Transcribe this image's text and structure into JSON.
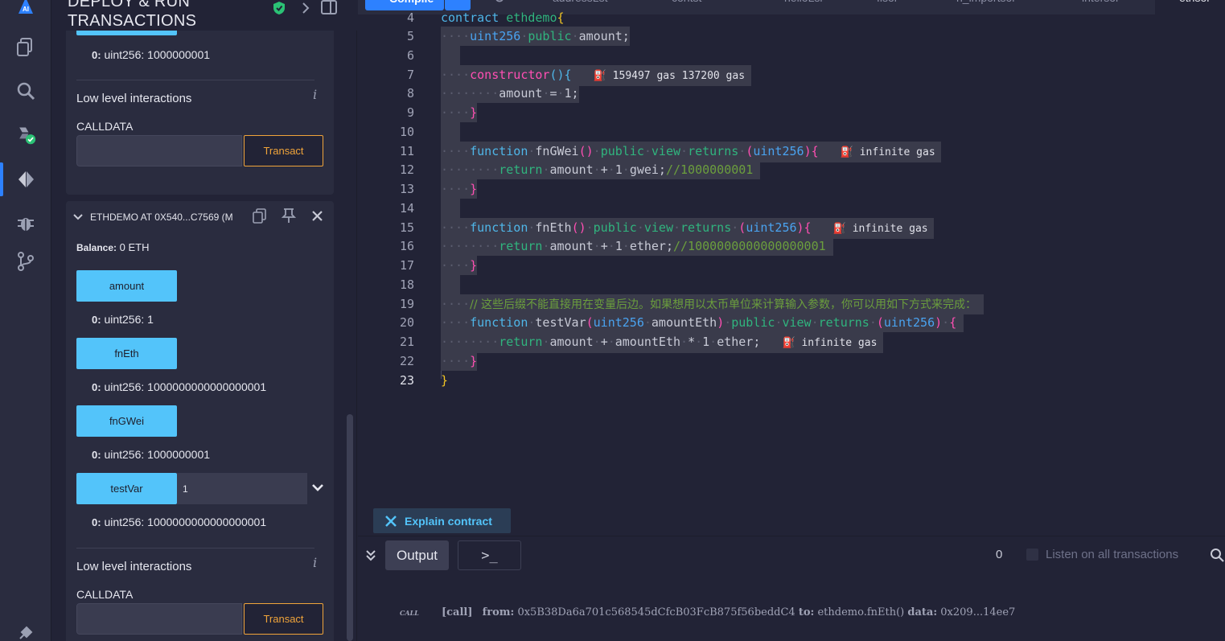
{
  "panel": {
    "title_line1": "DEPLOY & RUN",
    "title_line2": "TRANSACTIONS",
    "top_result": {
      "index": "0:",
      "value": "uint256: 1000000001"
    },
    "lli1": {
      "title": "Low level interactions",
      "info": "i",
      "calldata_label": "CALLDATA",
      "transact": "Transact"
    },
    "instance": {
      "name": "ETHDEMO AT 0X540...C7569 (M",
      "balance_label": "Balance:",
      "balance_value": "0 ETH",
      "functions": [
        {
          "label": "amount",
          "result_index": "0:",
          "result": "uint256: 1"
        },
        {
          "label": "fnEth",
          "result_index": "0:",
          "result": "uint256: 1000000000000000001"
        },
        {
          "label": "fnGWei",
          "result_index": "0:",
          "result": "uint256: 1000000001"
        },
        {
          "label": "testVar",
          "input_value": "1",
          "result_index": "0:",
          "result": "uint256: 1000000000000000001"
        }
      ]
    },
    "lli2": {
      "title": "Low level interactions",
      "info": "i",
      "calldata_label": "CALLDATA",
      "transact": "Transact"
    }
  },
  "editor": {
    "compile_label": "Compile",
    "tabs": [
      "addressLst",
      "contst",
      "helloLsr",
      "fisor",
      "n_importsor",
      "intersor",
      "ethsor"
    ],
    "gas": {
      "constructor": "159497 gas 137200 gas",
      "fnGWei": "infinite gas",
      "fnEth": "infinite gas",
      "testVar": "infinite gas"
    },
    "comments": {
      "gwei": "//1000000001",
      "ether": "//1000000000000000001",
      "cn": "// 这些后缀不能直接用在变量后边。如果想用以太币单位来计算输入参数，你可以用如下方式来完成："
    }
  },
  "explain_label": "Explain contract",
  "terminal": {
    "output_label": "Output",
    "prompt_label": ">_",
    "count": "0",
    "listen_label": "Listen on all transactions",
    "log": {
      "tag": "CALL",
      "kind": "[call]",
      "from_label": "from:",
      "from": "0x5B38Da6a701c568545dCfcB03FcB875f56beddC4",
      "to_label": "to:",
      "to": "ethdemo.fnEth()",
      "data_label": "data:",
      "data": "0x209...14ee7"
    }
  },
  "colors": {
    "accent": "#2d81ff",
    "function_button": "#53c4fa",
    "transact": "#f0a43a",
    "success": "#2bc275"
  }
}
